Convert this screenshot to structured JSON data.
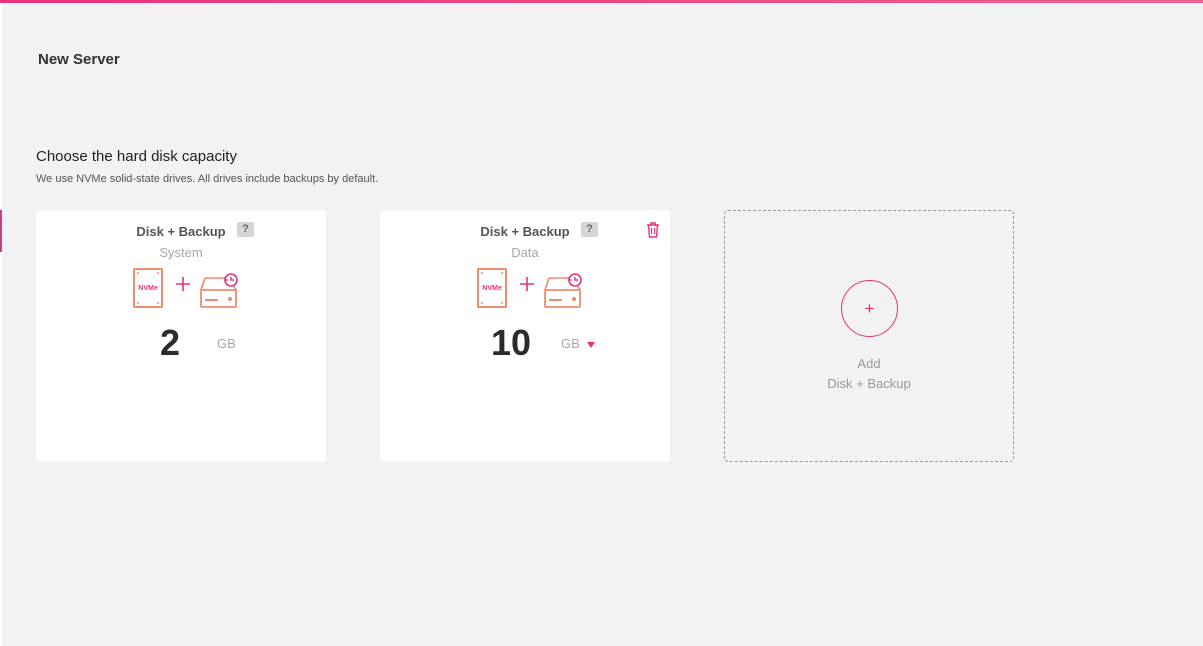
{
  "page": {
    "title": "New Server",
    "accent_color": "#e8317a"
  },
  "section": {
    "title": "Choose the hard disk capacity",
    "subtitle": "We use NVMe solid-state drives. All drives include backups by default."
  },
  "disks": [
    {
      "title": "Disk + Backup",
      "help": "?",
      "subtitle": "System",
      "drive_label": "NVMe",
      "plus": "+",
      "value": "2",
      "unit": "GB",
      "deletable": false,
      "icons": [
        "nvme-drive-icon",
        "plus-icon",
        "backup-drive-icon"
      ]
    },
    {
      "title": "Disk + Backup",
      "help": "?",
      "subtitle": "Data",
      "drive_label": "NVMe",
      "plus": "+",
      "value": "10",
      "unit": "GB",
      "deletable": true,
      "icons": [
        "nvme-drive-icon",
        "plus-icon",
        "backup-drive-icon",
        "trash-icon",
        "caret-down-icon"
      ]
    }
  ],
  "add_disk": {
    "plus": "+",
    "line1": "Add",
    "line2": "Disk + Backup"
  }
}
